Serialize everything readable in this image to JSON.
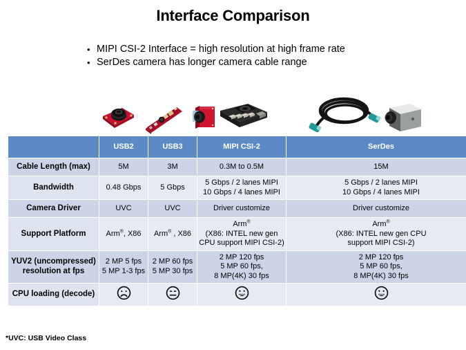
{
  "slide": {
    "title": "Interface Comparison",
    "bullets": [
      "MIPI CSI-2 Interface  = high resolution at high frame rate",
      "SerDes camera has longer camera cable range"
    ],
    "bullet_marker": "•",
    "footnote": "*UVC: USB Video Class"
  },
  "colors": {
    "header_blue": "#5b8ac5",
    "row_dark": "#ccd5e7",
    "row_light": "#e6eaf3",
    "label_dark": "#ccd5e7",
    "label_light": "#dde3ef",
    "grid_line": "#ffffff",
    "text": "#000000",
    "header_text": "#ffffff"
  },
  "images": [
    {
      "name": "usb2-camera-image",
      "alt": "red square USB2 camera board with black lens"
    },
    {
      "name": "usb3-camera-image",
      "alt": "thin red USB3 camera strip board"
    },
    {
      "name": "mipi-csi2-camera-image",
      "alt": "red MIPI CSI-2 camera module with black carrier board"
    },
    {
      "name": "serdes-camera-image",
      "alt": "coiled black coax cable with teal FAKRA connectors and gray box camera"
    }
  ],
  "table": {
    "corner_label": "",
    "columns": [
      "USB2",
      "USB3",
      "MIPI CSI-2",
      "SerDes"
    ],
    "rows": [
      {
        "label": "Cable Length (max)",
        "cells": [
          "5M",
          "3M",
          "0.3M to 0.5M",
          "15M"
        ]
      },
      {
        "label": "Bandwidth",
        "cells": [
          "0.48 Gbps",
          "5 Gbps",
          "5 Gbps / 2 lanes MIPI\n10 Gbps / 4 lanes MIPI",
          "5 Gbps / 2 lanes MIPI\n10 Gbps / 4 lanes MIPI"
        ]
      },
      {
        "label": "Camera Driver",
        "cells": [
          "UVC",
          "UVC",
          "Driver customize",
          "Driver customize"
        ]
      },
      {
        "label": "Support Platform",
        "cells_html": [
          "Arm<sup>®</sup>, X86",
          "Arm<sup>®</sup> , X86",
          "Arm<sup>®</sup><br>(X86: INTEL new gen<br>CPU support MIPI CSI-2)",
          "Arm<sup>®</sup><br>(X86: INTEL new gen CPU<br>support MIPI CSI-2)"
        ]
      },
      {
        "label": "YUV2 (uncompressed)\nresolution at fps",
        "cells": [
          "2 MP 5 fps\n5 MP 1-3 fps",
          "2 MP 60 fps\n5 MP 30 fps",
          "2 MP 120 fps\n5 MP 60 fps,\n8 MP(4K) 30 fps",
          "2 MP 120 fps\n5 MP 60 fps,\n8 MP(4K) 30 fps"
        ]
      },
      {
        "label": "CPU loading (decode)",
        "faces": [
          "frowning-face",
          "neutral-face",
          "smiling-face",
          "smiling-face"
        ]
      }
    ]
  }
}
